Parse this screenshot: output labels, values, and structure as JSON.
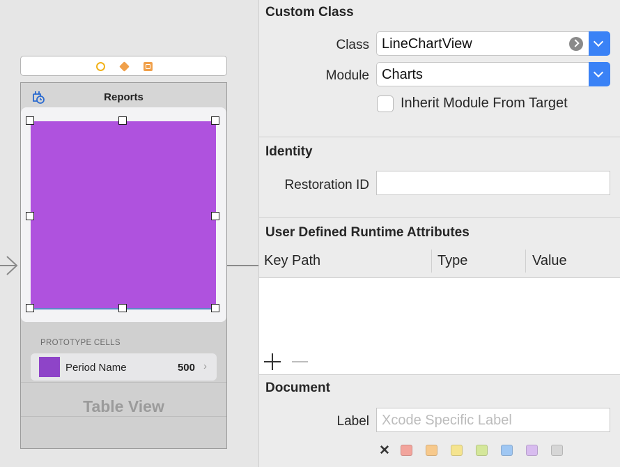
{
  "canvas": {
    "nav_title": "Reports",
    "prototype_cells_label": "PROTOTYPE CELLS",
    "cell": {
      "title": "Period Name",
      "value": "500",
      "chevron": "›"
    },
    "table_view_label": "Table View",
    "chart_color": "#af52de",
    "cell_swatch_color": "#8e44c8",
    "scene_icons": [
      "view-controller-icon",
      "first-responder-icon",
      "exit-icon"
    ]
  },
  "inspector": {
    "custom_class": {
      "title": "Custom Class",
      "class_label": "Class",
      "class_value": "LineChartView",
      "module_label": "Module",
      "module_value": "Charts",
      "inherit_label": "Inherit Module From Target",
      "inherit_checked": false
    },
    "identity": {
      "title": "Identity",
      "restoration_label": "Restoration ID",
      "restoration_value": ""
    },
    "runtime_attributes": {
      "title": "User Defined Runtime Attributes",
      "columns": [
        "Key Path",
        "Type",
        "Value"
      ],
      "add_symbol": "+",
      "rows": []
    },
    "document": {
      "title": "Document",
      "label_label": "Label",
      "label_placeholder": "Xcode Specific Label",
      "clear_symbol": "✕",
      "label_colors": [
        "#f2a49c",
        "#f7c98c",
        "#f5e48f",
        "#d4e79a",
        "#9fc7f3",
        "#d8bcef",
        "#d6d6d6"
      ]
    },
    "accent_color": "#3a82f6"
  }
}
